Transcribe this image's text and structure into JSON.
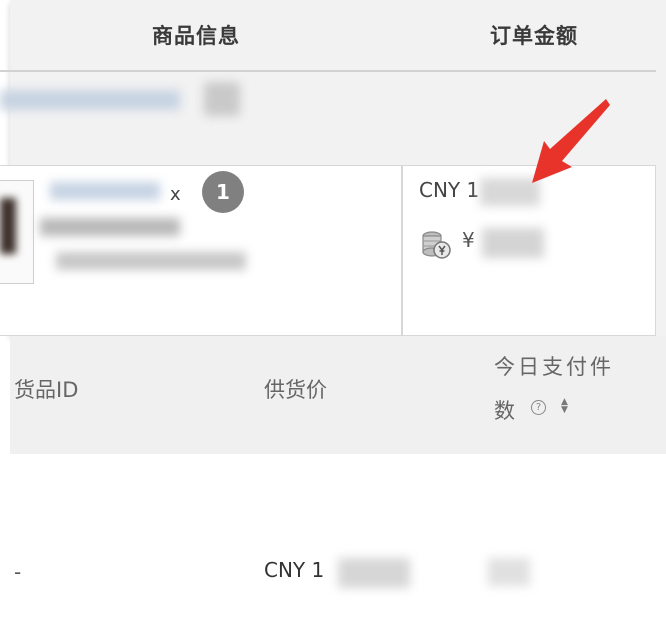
{
  "table_header": {
    "product_info": "商品信息",
    "order_amount": "订单金额"
  },
  "order_row": {
    "quantity_prefix": "x",
    "quantity": "1",
    "amount_currency": "CNY 1",
    "yen_symbol": "¥"
  },
  "list_header": {
    "goods_id": "货品ID",
    "supply_price": "供货价",
    "today_payments_line1": "今日支付件",
    "today_payments_line2": "数",
    "help_glyph": "?",
    "sort_glyph_up": "▲",
    "sort_glyph_down": "▼"
  },
  "list_row": {
    "goods_id": "-",
    "supply_price": "CNY 1"
  },
  "icons": {
    "coin": "coin-stack-icon",
    "help": "question-circle-icon",
    "sort": "sort-icon",
    "annotation": "red-arrow-annotation"
  },
  "colors": {
    "arrow": "#e8332a",
    "badge": "#808080"
  }
}
